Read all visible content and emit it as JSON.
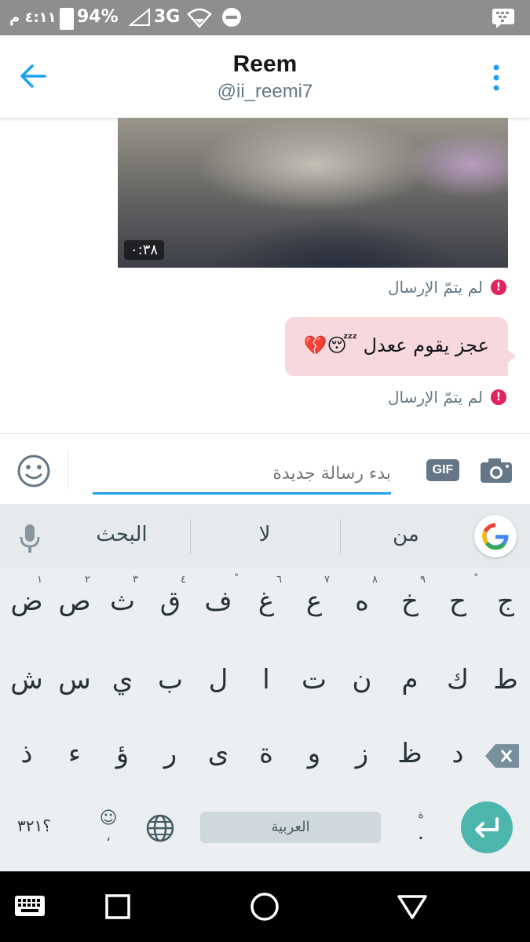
{
  "status_bar": {
    "time": "٤:١١ م",
    "battery": "94%",
    "network": "3G"
  },
  "header": {
    "name": "Reem",
    "handle": "@ii_reemi7"
  },
  "messages": [
    {
      "type": "video",
      "duration": "٠:٣٨",
      "status": "لم يتمّ الإرسال"
    },
    {
      "type": "text",
      "text": "عجز يقوم ععدل 😴💔",
      "status": "لم يتمّ الإرسال"
    }
  ],
  "composer": {
    "placeholder": "بدء رسالة جديدة",
    "gif_label": "GIF"
  },
  "keyboard": {
    "suggestions": [
      "البحث",
      "لا",
      "من"
    ],
    "row1": [
      {
        "k": "ض",
        "h": "١"
      },
      {
        "k": "ص",
        "h": "٢"
      },
      {
        "k": "ث",
        "h": "٣"
      },
      {
        "k": "ق",
        "h": "٤"
      },
      {
        "k": "ف",
        "h": "ْ"
      },
      {
        "k": "غ",
        "h": "٦"
      },
      {
        "k": "ع",
        "h": "٧"
      },
      {
        "k": "ه",
        "h": "٨"
      },
      {
        "k": "خ",
        "h": "٩"
      },
      {
        "k": "ح",
        "h": "ْ"
      },
      {
        "k": "ج",
        "h": ""
      }
    ],
    "row2": [
      "ش",
      "س",
      "ي",
      "ب",
      "ل",
      "ا",
      "ت",
      "ن",
      "م",
      "ك",
      "ط"
    ],
    "row3": [
      "ذ",
      "ء",
      "ؤ",
      "ر",
      "ى",
      "ة",
      "و",
      "ز",
      "ظ",
      "د"
    ],
    "numbers_label": "؟٣٢١",
    "emoji_label": "☺",
    "emoji_sub": "،",
    "space_label": "العربية",
    "period_label": ".",
    "period_hint": "ة"
  },
  "colors": {
    "accent": "#1da1f2",
    "bubble": "#f6d8dd",
    "error": "#e0245e",
    "enter": "#4db6ac"
  }
}
